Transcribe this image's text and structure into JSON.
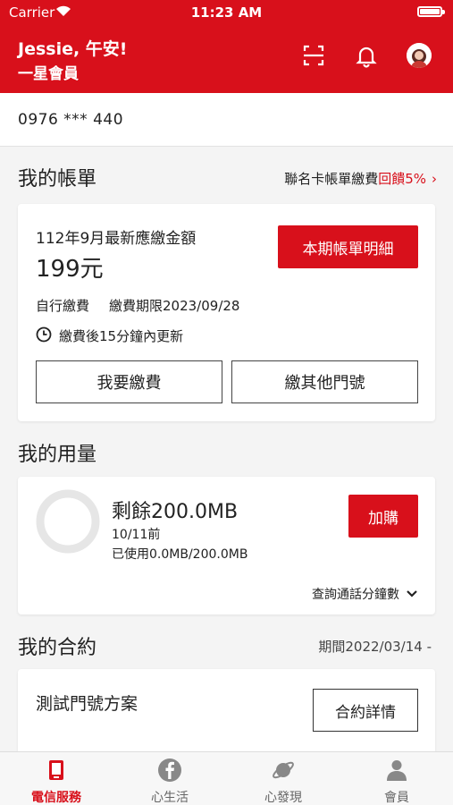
{
  "status_bar": {
    "carrier": "Carrier",
    "time": "11:23 AM"
  },
  "header": {
    "greeting": "Jessie, 午安!",
    "member_level": "一星會員"
  },
  "account": {
    "phone": "0976 *** 440"
  },
  "bill": {
    "section_title": "我的帳單",
    "promo_prefix": "聯名卡帳單繳費",
    "promo_highlight": "回饋5%",
    "promo_arrow": "›",
    "title": "112年9月最新應繳金額",
    "amount": "199元",
    "detail_button": "本期帳單明細",
    "pay_method": "自行繳費",
    "deadline": "繳費期限2023/09/28",
    "update_note": "繳費後15分鐘內更新",
    "pay_button": "我要繳費",
    "pay_other_button": "繳其他門號"
  },
  "usage": {
    "section_title": "我的用量",
    "remaining": "剩餘200.0MB",
    "date": "10/11前",
    "used": "已使用0.0MB/200.0MB",
    "used_fraction": 0,
    "topup_button": "加購",
    "query_minutes": "查詢通話分鐘數"
  },
  "contract": {
    "section_title": "我的合約",
    "period": "期間2022/03/14 -",
    "plan_name": "測試門號方案",
    "detail_button": "合約詳情"
  },
  "tabs": [
    {
      "label": "電信服務",
      "icon": "phone-icon",
      "active": true
    },
    {
      "label": "心生活",
      "icon": "facebook-icon",
      "active": false
    },
    {
      "label": "心發現",
      "icon": "planet-icon",
      "active": false
    },
    {
      "label": "會員",
      "icon": "person-icon",
      "active": false
    }
  ],
  "colors": {
    "brand": "#d8101b",
    "background": "#f4f4f4"
  }
}
